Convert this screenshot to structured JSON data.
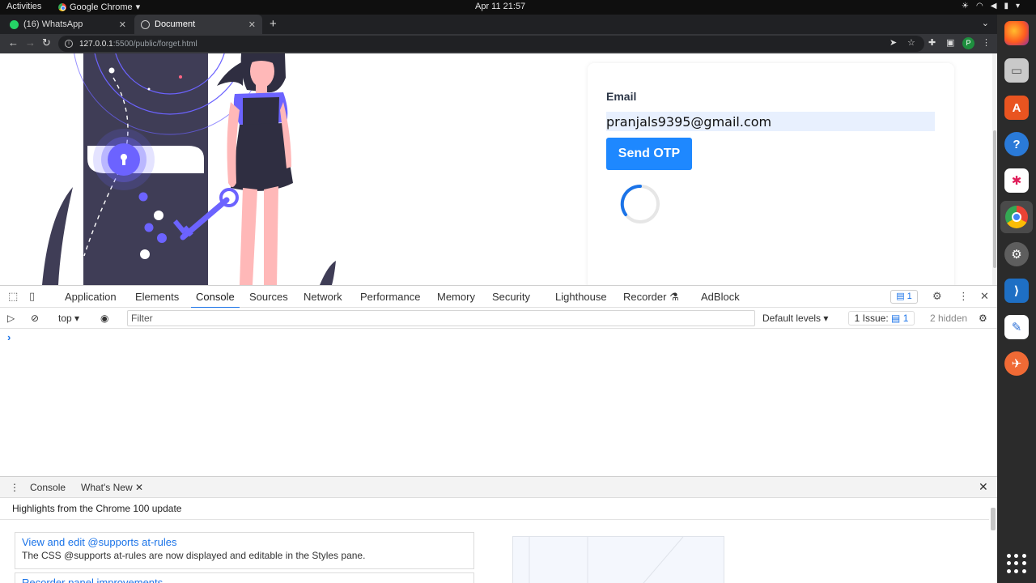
{
  "topbar": {
    "activities": "Activities",
    "app_name": "Google Chrome",
    "clock": "Apr 11  21:57"
  },
  "browser": {
    "tabs": [
      {
        "label": "(16) WhatsApp",
        "favicon": "whatsapp-icon"
      },
      {
        "label": "Document",
        "favicon": "globe-icon",
        "active": true
      }
    ],
    "url_host": "127.0.0.1",
    "url_path": ":5500/public/forget.html",
    "profile_initial": "P"
  },
  "page": {
    "email_label": "Email",
    "email_value": "pranjals9395@gmail.com",
    "send_button": "Send OTP",
    "accent_color": "#1e88ff"
  },
  "devtools": {
    "tabs": [
      "Application",
      "Elements",
      "Console",
      "Sources",
      "Network",
      "Performance",
      "Memory",
      "Security",
      "Lighthouse",
      "Recorder",
      "AdBlock"
    ],
    "active_tab": "Console",
    "issue_count": "1",
    "context": "top",
    "filter_placeholder": "Filter",
    "levels": "Default levels",
    "issues_label": "1 Issue:",
    "issues_count": "1",
    "hidden": "2 hidden",
    "drawer_tabs": [
      "Console",
      "What's New"
    ],
    "whats_new": {
      "heading": "Highlights from the Chrome 100 update",
      "items": [
        {
          "title": "View and edit @supports at-rules",
          "desc": "The CSS @supports at-rules are now displayed and editable in the Styles pane."
        },
        {
          "title": "Recorder panel improvements",
          "desc": ""
        }
      ]
    }
  }
}
